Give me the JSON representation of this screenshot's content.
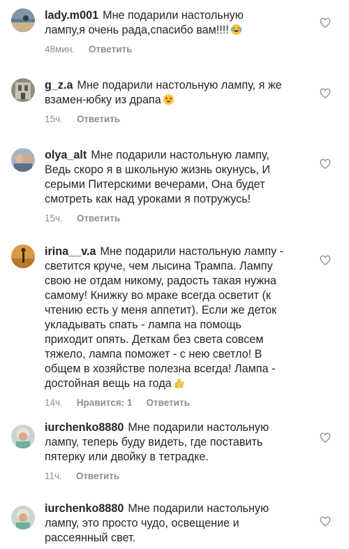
{
  "comments": [
    {
      "username": "lady.m001",
      "text": "Мне подарили настольную\nлампу,я очень рада,спасибо вам!!!!",
      "emoji": "laughing-tears",
      "time": "48мин.",
      "likes": "",
      "reply": "Ответить"
    },
    {
      "username": "g_z.a",
      "text": "Мне подарили настольную лампу, я же\nвзамен-юбку из драпа",
      "emoji": "star-struck",
      "time": "15ч.",
      "likes": "",
      "reply": "Ответить"
    },
    {
      "username": "olya_alt",
      "text": "Мне подарили настольную лампу,\nВедь скоро я в школьную жизнь окунусь, И\nсерыми Питерскими вечерами, Она будет\nсмотреть как над уроками я потружусь!",
      "emoji": "",
      "time": "15ч.",
      "likes": "",
      "reply": "Ответить"
    },
    {
      "username": "irina__v.a",
      "text": "Мне подарили настольную лампу -\nсветится круче, чем лысина Трампа. Лампу\nсвою не отдам никому, радость такая нужна\nсамому! Книжку во мраке всегда осветит (к\nчтению есть у меня аппетит). Если же деток\nукладывать спать - лампа на помощь\nприходит опять. Деткам без света совсем\nтяжело, лампа поможет - с нею светло! В\nобщем в хозяйстве полезна всегда! Лампа -\nдостойная вещь на года",
      "emoji": "thumbs-up",
      "time": "14ч.",
      "likes": "Нравится: 1",
      "reply": "Ответить"
    },
    {
      "username": "iurchenko8880",
      "text": "Мне подарили настольную\nлампу, теперь буду видеть, где поставить\nпятерку или двойку в тетрадке.",
      "emoji": "",
      "time": "11ч.",
      "likes": "",
      "reply": "Ответить"
    },
    {
      "username": "iurchenko8880",
      "text": "Мне подарили настольную\nлампу, это просто чудо, освещение и\nрассеянный свет.",
      "emoji": "",
      "time": "",
      "likes": "",
      "reply": ""
    }
  ]
}
